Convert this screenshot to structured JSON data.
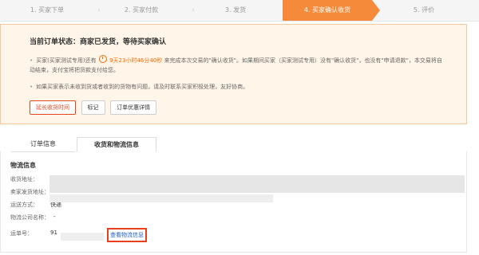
{
  "steps": [
    {
      "label": "1. 买家下单"
    },
    {
      "label": "2. 买家付款"
    },
    {
      "label": "3. 发货"
    },
    {
      "label": "4. 买家确认收货"
    },
    {
      "label": "5. 评价"
    }
  ],
  "status": {
    "title": "当前订单状态：商家已发货，等待买家确认",
    "note1_pre": "买家(买家测试专用)还有",
    "note1_time": "9天23小时46分40秒",
    "note1_post": "来完成本次交易的\"确认收货\"。如果期间买家（买家测试专用）没有\"确认收货\"，也没有\"申请退款\"，本交易将自动结束，支付宝将把货款支付给您。",
    "note2": "如果买家表示未收到货或者收到的货物有问题，请及时联系买家积极处理，友好协商。",
    "buttons": {
      "extend": "延长收货时间",
      "mark": "标记",
      "discount": "订单优惠详情"
    }
  },
  "tabs": {
    "order_info": "订单信息",
    "shipping": "收货和物流信息"
  },
  "logistics": {
    "section_title": "物流信息",
    "address_label": "收货地址：",
    "origin_label": "卖家发货地址：",
    "method_label": "运送方式：",
    "method_value": "快递",
    "company_label": "物流公司名称：",
    "company_value": "-",
    "tracking_label": "运单号：",
    "tracking_value": "91",
    "view_link": "查看物流信息"
  },
  "colors": {
    "accent": "#f58b3a",
    "highlight": "#e8401c",
    "link": "#1d5ec9"
  }
}
